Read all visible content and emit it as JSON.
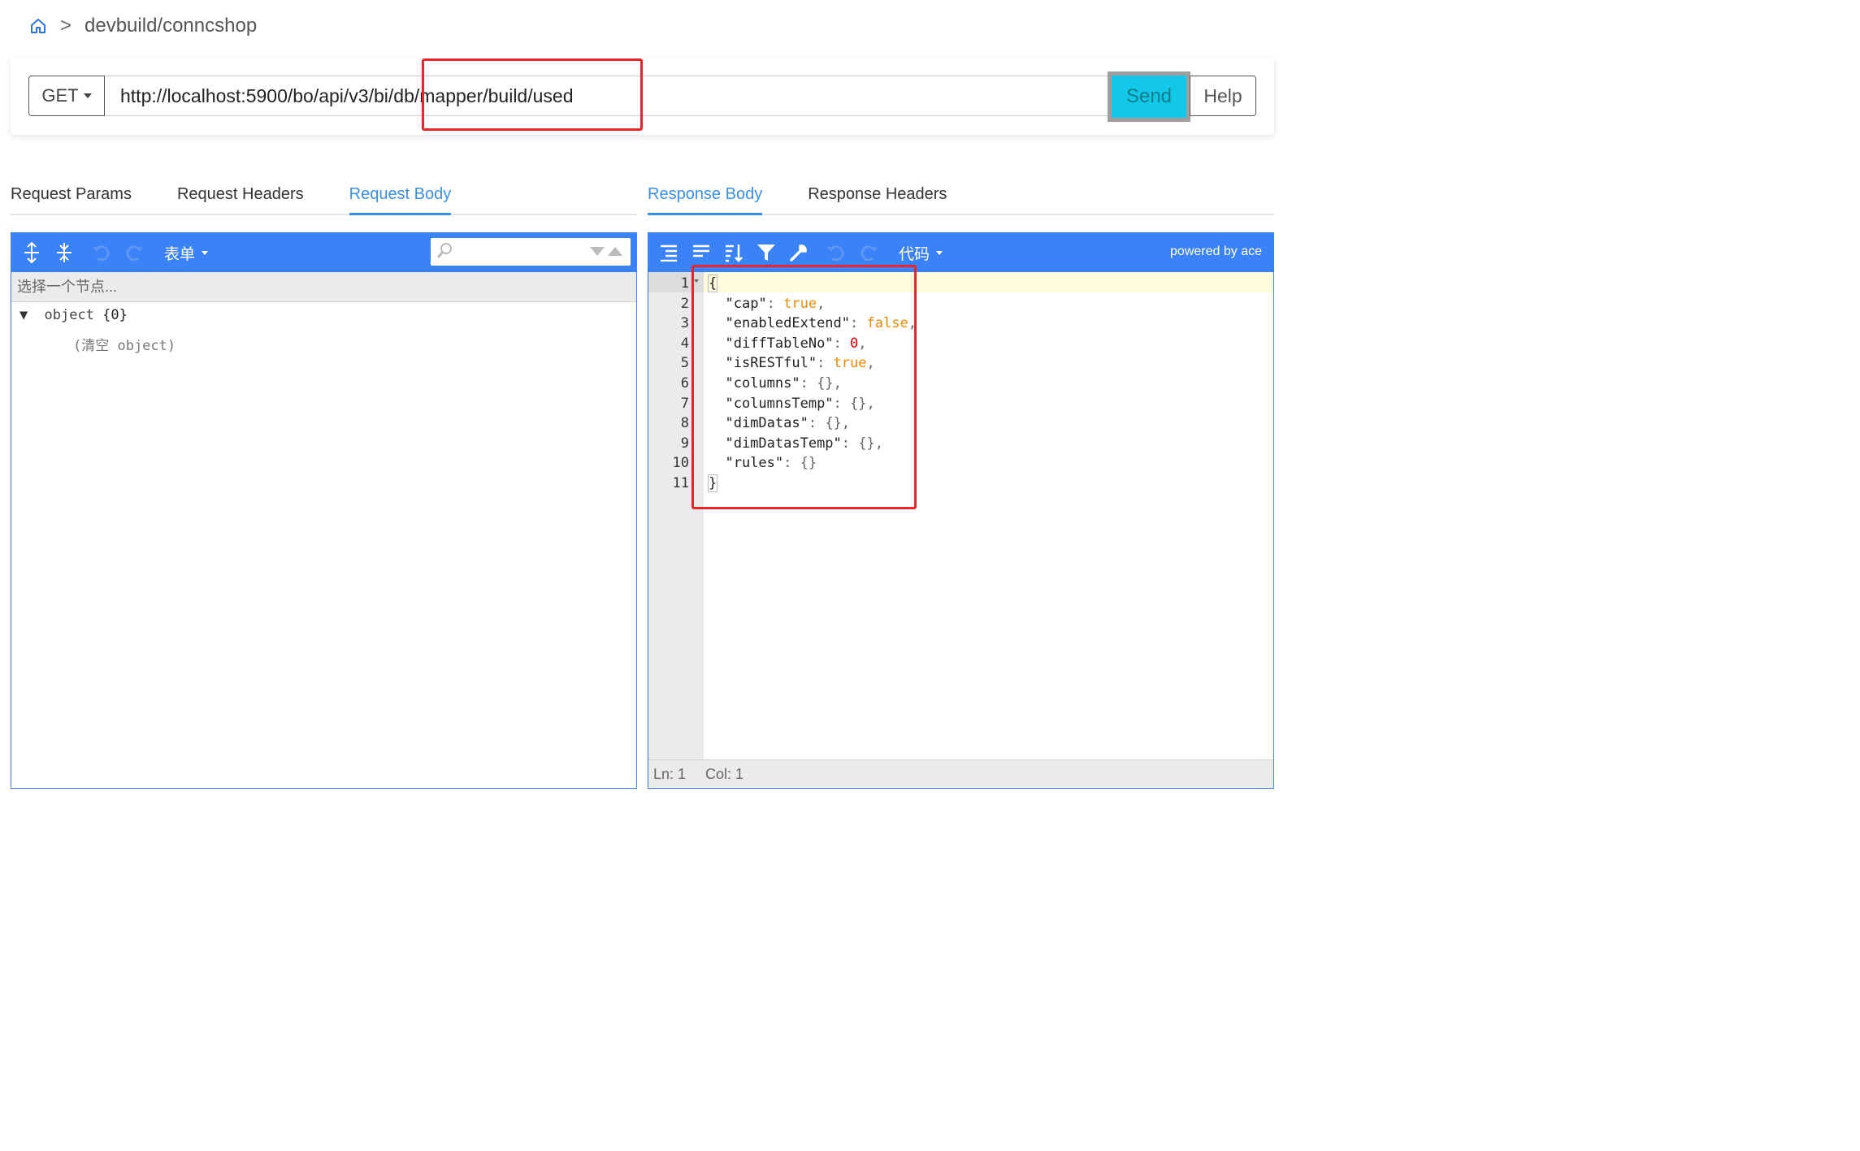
{
  "breadcrumb": {
    "separator": ">",
    "path": "devbuild/conncshop"
  },
  "urlbar": {
    "method": "GET",
    "url": "http://localhost:5900/bo/api/v3/bi/db/mapper/build/used",
    "send_label": "Send",
    "help_label": "Help"
  },
  "request_tabs": [
    {
      "label": "Request Params",
      "active": false
    },
    {
      "label": "Request Headers",
      "active": false
    },
    {
      "label": "Request Body",
      "active": true
    }
  ],
  "response_tabs": [
    {
      "label": "Response Body",
      "active": true
    },
    {
      "label": "Response Headers",
      "active": false
    }
  ],
  "request_editor": {
    "mode_label": "表单",
    "path_placeholder": "选择一个节点...",
    "tree_root": "object",
    "tree_root_count": "{0}",
    "tree_empty_hint": "(清空 object)",
    "icons": [
      "expand-all-icon",
      "collapse-all-icon",
      "undo-icon",
      "redo-icon",
      "search-icon",
      "search-next-icon",
      "search-prev-icon"
    ]
  },
  "response_editor": {
    "mode_label": "代码",
    "powered_by": "powered by ace",
    "icons": [
      "format-icon",
      "compact-icon",
      "sort-icon",
      "filter-icon",
      "repair-icon",
      "undo-icon",
      "redo-icon"
    ],
    "line_numbers": [
      "1",
      "2",
      "3",
      "4",
      "5",
      "6",
      "7",
      "8",
      "9",
      "10",
      "11"
    ],
    "lines": [
      {
        "text": "{"
      },
      {
        "key": "\"cap\"",
        "value": "true",
        "type": "bool",
        "trail": ","
      },
      {
        "key": "\"enabledExtend\"",
        "value": "false",
        "type": "bool",
        "trail": ","
      },
      {
        "key": "\"diffTableNo\"",
        "value": "0",
        "type": "num",
        "trail": ","
      },
      {
        "key": "\"isRESTful\"",
        "value": "true",
        "type": "bool",
        "trail": ","
      },
      {
        "key": "\"columns\"",
        "value": "{}",
        "type": "obj",
        "trail": ","
      },
      {
        "key": "\"columnsTemp\"",
        "value": "{}",
        "type": "obj",
        "trail": ","
      },
      {
        "key": "\"dimDatas\"",
        "value": "{}",
        "type": "obj",
        "trail": ","
      },
      {
        "key": "\"dimDatasTemp\"",
        "value": "{}",
        "type": "obj",
        "trail": ","
      },
      {
        "key": "\"rules\"",
        "value": "{}",
        "type": "obj",
        "trail": ""
      },
      {
        "text": "}"
      }
    ],
    "status_ln": "Ln: 1",
    "status_col": "Col: 1"
  },
  "colors": {
    "accent": "#3b82f6",
    "tab_active": "#3a8ee6",
    "send_bg": "#13c8e6",
    "highlight": "#e8262a",
    "json_bool": "#f08a00",
    "json_num": "#e00000"
  }
}
